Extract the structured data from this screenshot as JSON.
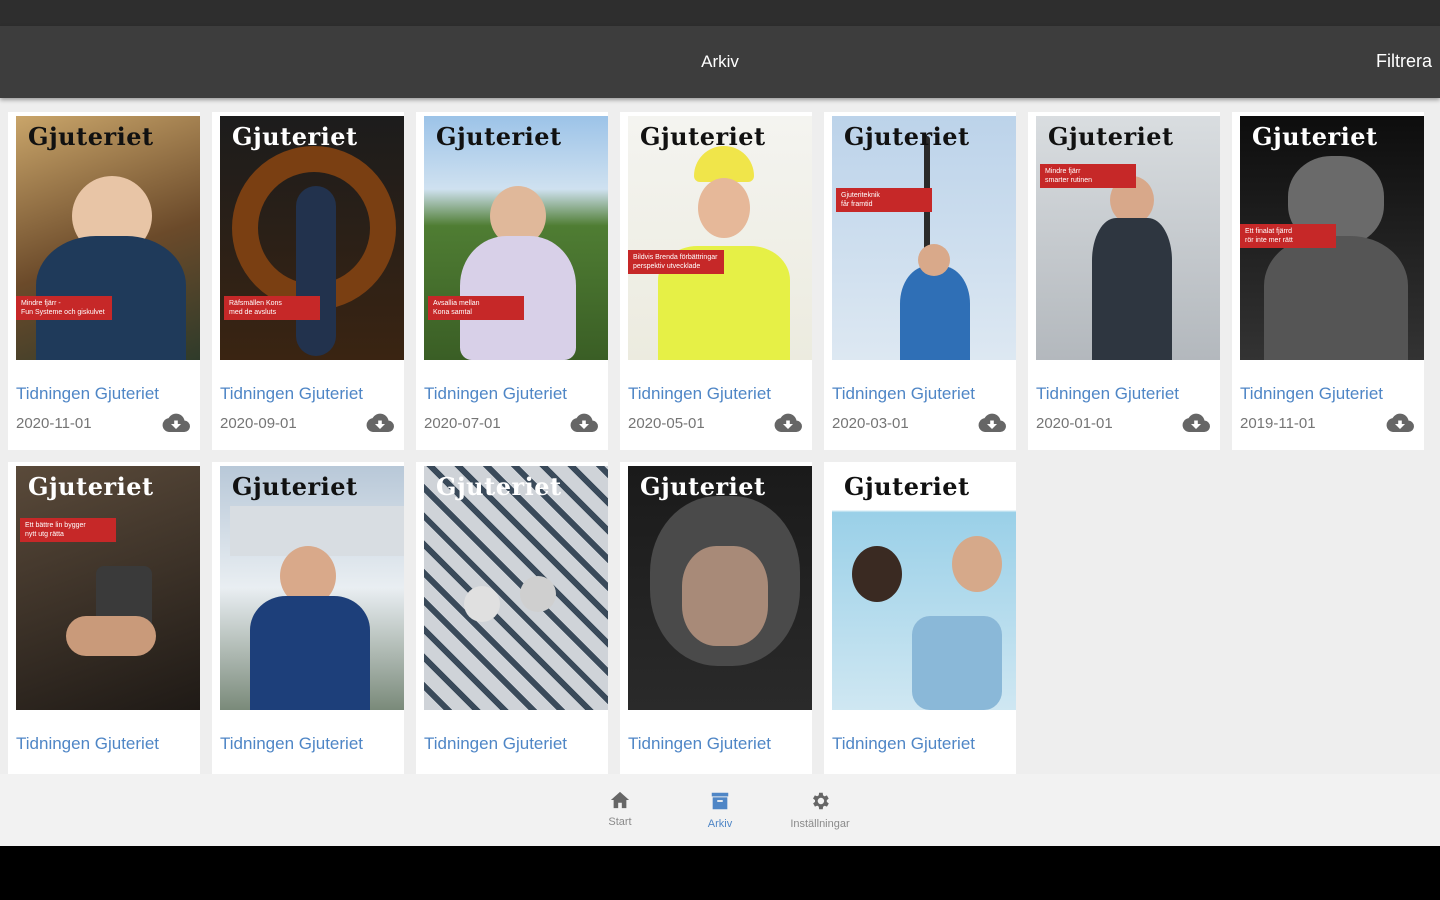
{
  "appbar": {
    "title": "Arkiv",
    "filter_label": "Filtrera"
  },
  "issues": [
    {
      "title": "Tidningen Gjuteriet",
      "date": "2020-11-01",
      "masthead": "Gjuteriet",
      "tag": "Mindre fjärr -\nFun Systeme och giskulvet",
      "theme": "man-autumn"
    },
    {
      "title": "Tidningen Gjuteriet",
      "date": "2020-09-01",
      "masthead": "Gjuteriet",
      "tag": "Räfsmällen Kons\nmed de avsluts",
      "theme": "ring"
    },
    {
      "title": "Tidningen Gjuteriet",
      "date": "2020-07-01",
      "masthead": "Gjuteriet",
      "tag": "Avsallia mellan\nKona samtal",
      "theme": "woman-field"
    },
    {
      "title": "Tidningen Gjuteriet",
      "date": "2020-05-01",
      "masthead": "Gjuteriet",
      "tag": "Bildvis Brenda förbättringar\nperspektiv utvecklade",
      "theme": "helmet-yellow"
    },
    {
      "title": "Tidningen Gjuteriet",
      "date": "2020-03-01",
      "masthead": "Gjuteriet",
      "tag": "Gjuteriteknik \nfår framtid",
      "theme": "wind"
    },
    {
      "title": "Tidningen Gjuteriet",
      "date": "2020-01-01",
      "masthead": "Gjuteriet",
      "tag": "Mindre fjärr\nsmarter rutinen",
      "theme": "man-factory"
    },
    {
      "title": "Tidningen Gjuteriet",
      "date": "2019-11-01",
      "masthead": "Gjuteriet",
      "tag": "Ett finalat fjärrd\nrör inte mer rätt",
      "theme": "dark-diver"
    },
    {
      "title": "Tidningen Gjuteriet",
      "date": "",
      "masthead": "Gjuteriet",
      "tag": "Ett bättre lin bygger\nnytt utg rätta",
      "theme": "cup"
    },
    {
      "title": "Tidningen Gjuteriet",
      "date": "",
      "masthead": "Gjuteriet",
      "tag": "",
      "theme": "volvo"
    },
    {
      "title": "Tidningen Gjuteriet",
      "date": "",
      "masthead": "Gjuteriet",
      "tag": "",
      "theme": "maze"
    },
    {
      "title": "Tidningen Gjuteriet",
      "date": "",
      "masthead": "Gjuteriet",
      "tag": "",
      "theme": "visor"
    },
    {
      "title": "Tidningen Gjuteriet",
      "date": "",
      "masthead": "Gjuteriet",
      "tag": "",
      "theme": "lab"
    }
  ],
  "nav": [
    {
      "label": "Start",
      "icon": "home-icon",
      "active": false
    },
    {
      "label": "Arkiv",
      "icon": "archive-icon",
      "active": true
    },
    {
      "label": "Inställningar",
      "icon": "gear-icon",
      "active": false
    }
  ],
  "colors": {
    "accent": "#4f86c6",
    "appbar": "#3d3d3d",
    "tag_red": "#c62828"
  }
}
